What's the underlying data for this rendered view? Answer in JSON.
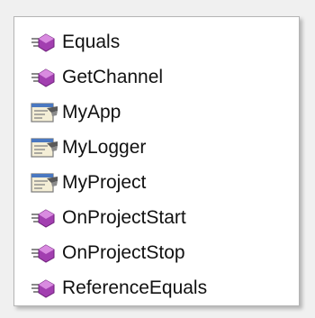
{
  "completion_list": {
    "items": [
      {
        "label": "Equals",
        "icon": "method-icon"
      },
      {
        "label": "GetChannel",
        "icon": "method-icon"
      },
      {
        "label": "MyApp",
        "icon": "property-icon"
      },
      {
        "label": "MyLogger",
        "icon": "property-icon"
      },
      {
        "label": "MyProject",
        "icon": "property-icon"
      },
      {
        "label": "OnProjectStart",
        "icon": "method-icon"
      },
      {
        "label": "OnProjectStop",
        "icon": "method-icon"
      },
      {
        "label": "ReferenceEquals",
        "icon": "method-icon"
      }
    ]
  },
  "colors": {
    "method_icon": "#a23fb0",
    "property_icon_doc": "#e8e0c0",
    "property_icon_hand": "#6a6a6a"
  }
}
